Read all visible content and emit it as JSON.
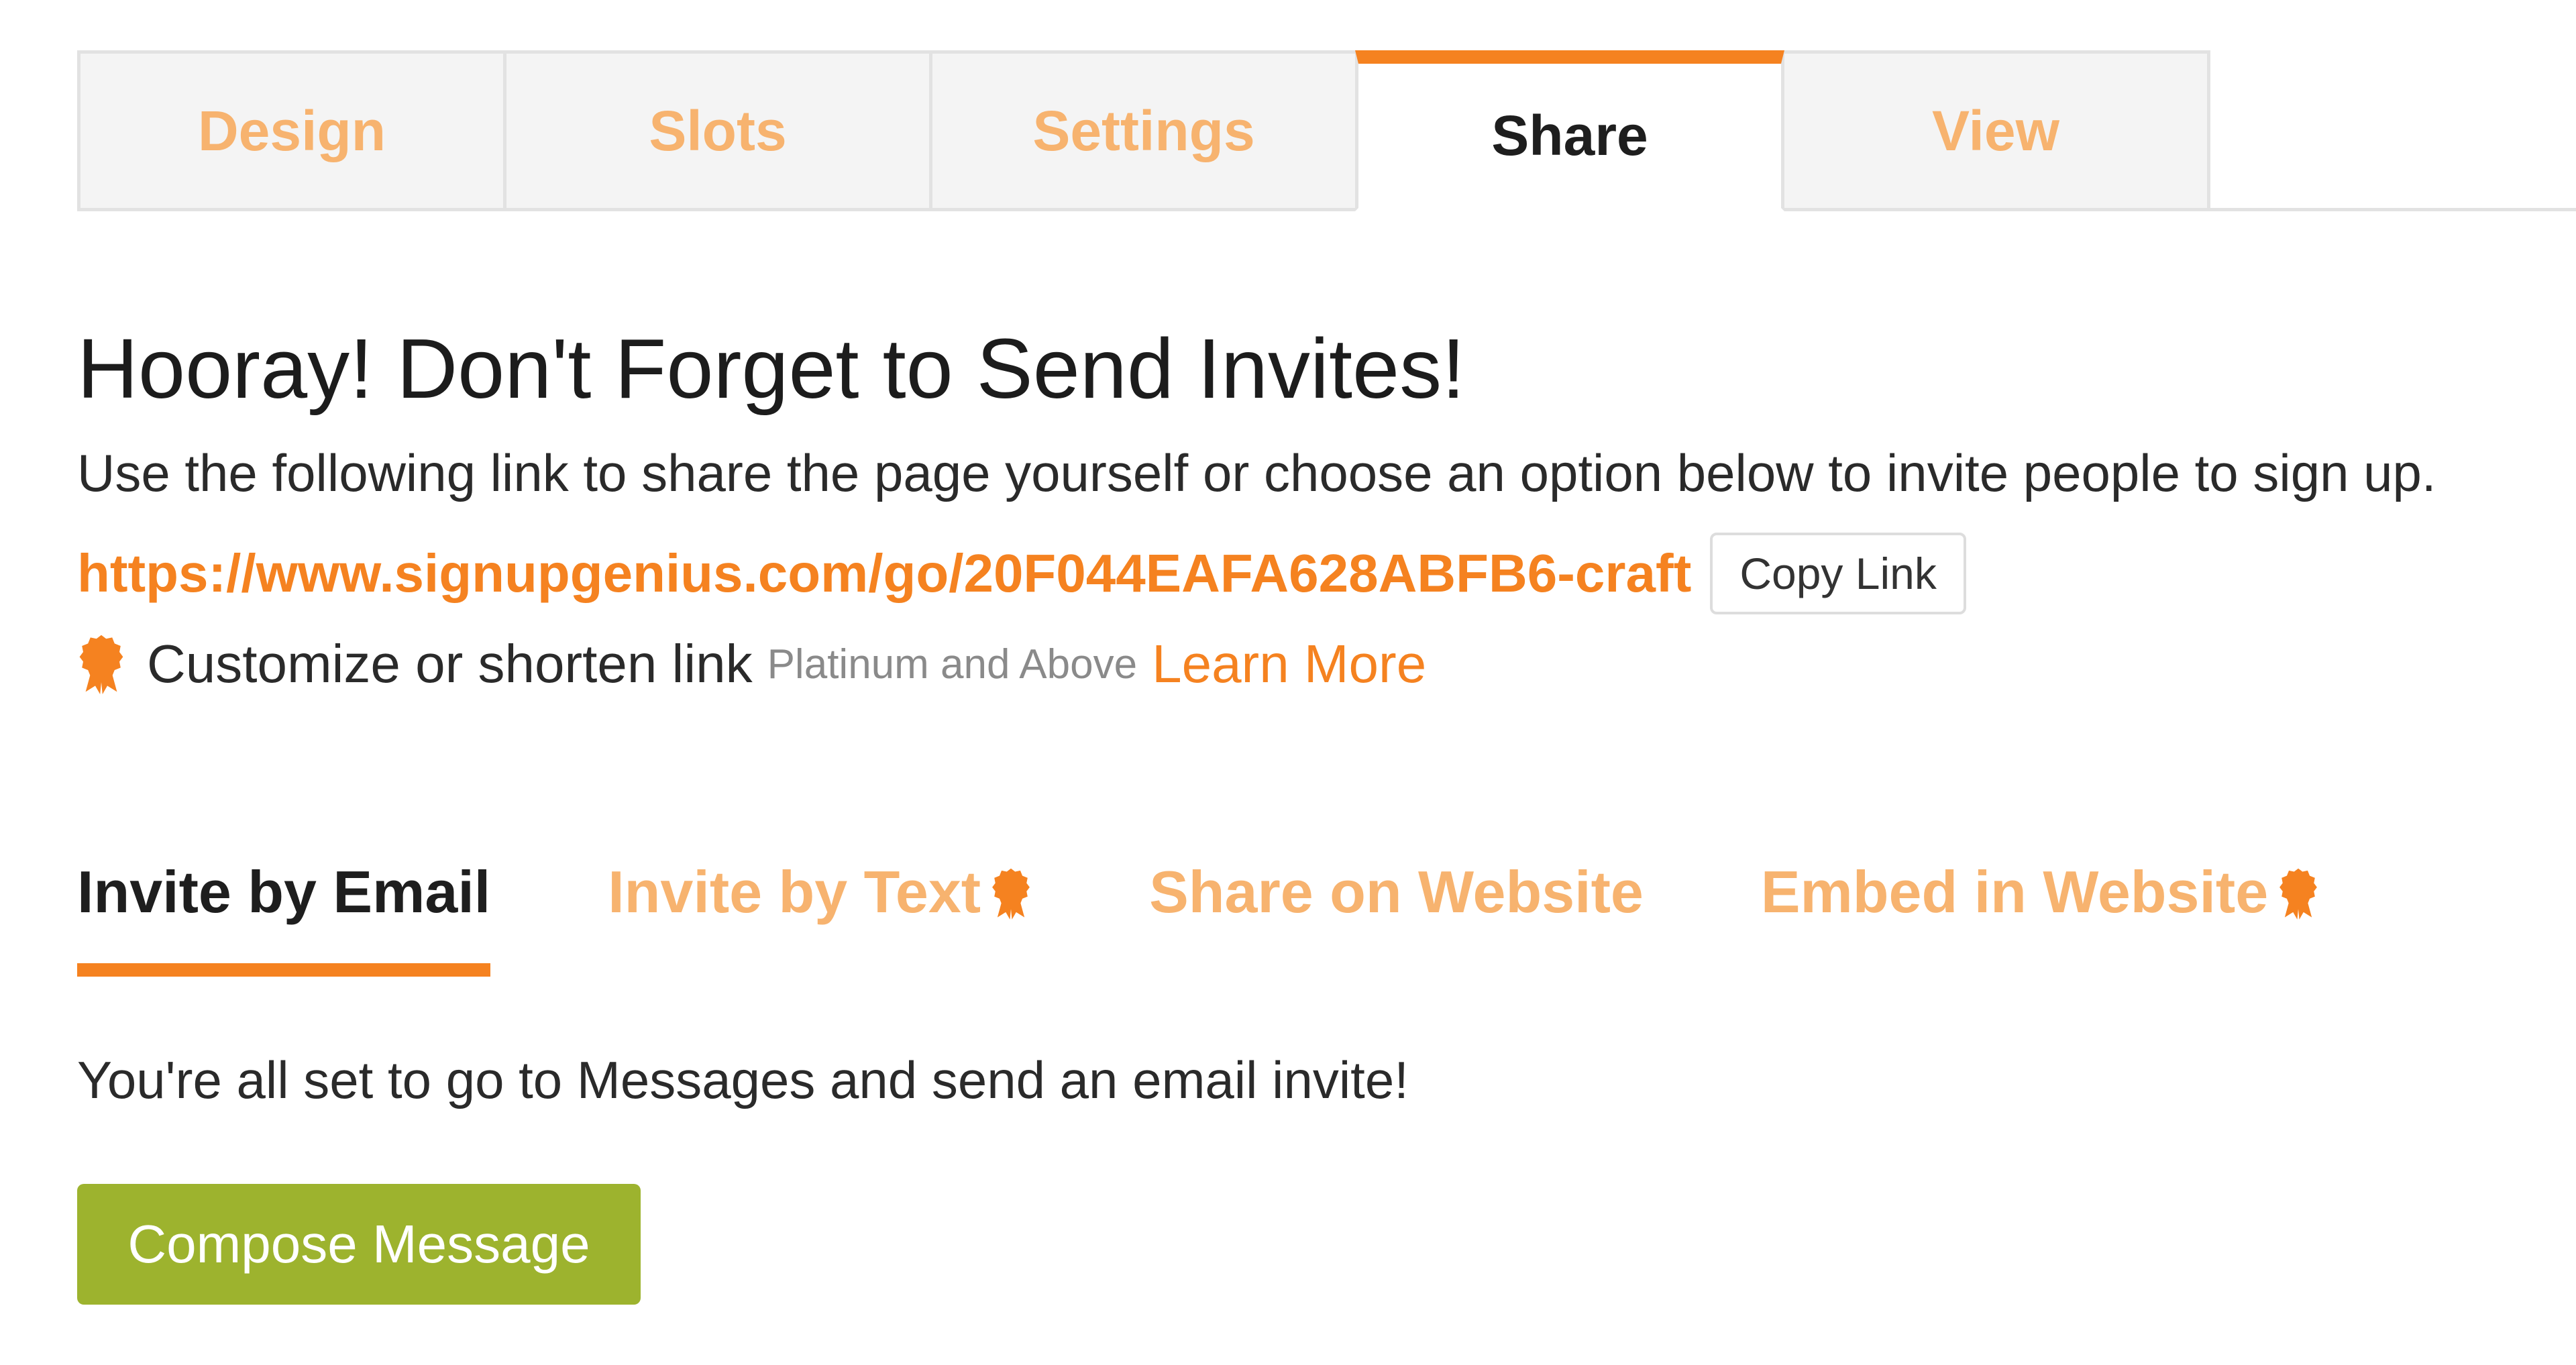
{
  "colors": {
    "accent": "#f58220",
    "inactive_tab_text": "#f7b36f",
    "compose_button": "#9db32e"
  },
  "main_tabs": [
    {
      "label": "Design",
      "active": false
    },
    {
      "label": "Slots",
      "active": false
    },
    {
      "label": "Settings",
      "active": false
    },
    {
      "label": "Share",
      "active": true
    },
    {
      "label": "View",
      "active": false
    }
  ],
  "share": {
    "headline": "Hooray! Don't Forget to Send Invites!",
    "intro": "Use the following link to share the page yourself or choose an option below to invite people to sign up.",
    "link": "https://www.signupgenius.com/go/20F044EAFA628ABFB6-craft",
    "copy_label": "Copy Link",
    "customize_label": "Customize or shorten link",
    "tier_label": "Platinum and Above",
    "learn_more_label": "Learn More",
    "premium_icon": "ribbon-badge-icon"
  },
  "invite_tabs": [
    {
      "label": "Invite by Email",
      "active": true,
      "premium": false
    },
    {
      "label": "Invite by Text",
      "active": false,
      "premium": true
    },
    {
      "label": "Share on Website",
      "active": false,
      "premium": false
    },
    {
      "label": "Embed in Website",
      "active": false,
      "premium": true
    }
  ],
  "email": {
    "status": "You're all set to go to Messages and send an email invite!",
    "compose_label": "Compose Message"
  }
}
